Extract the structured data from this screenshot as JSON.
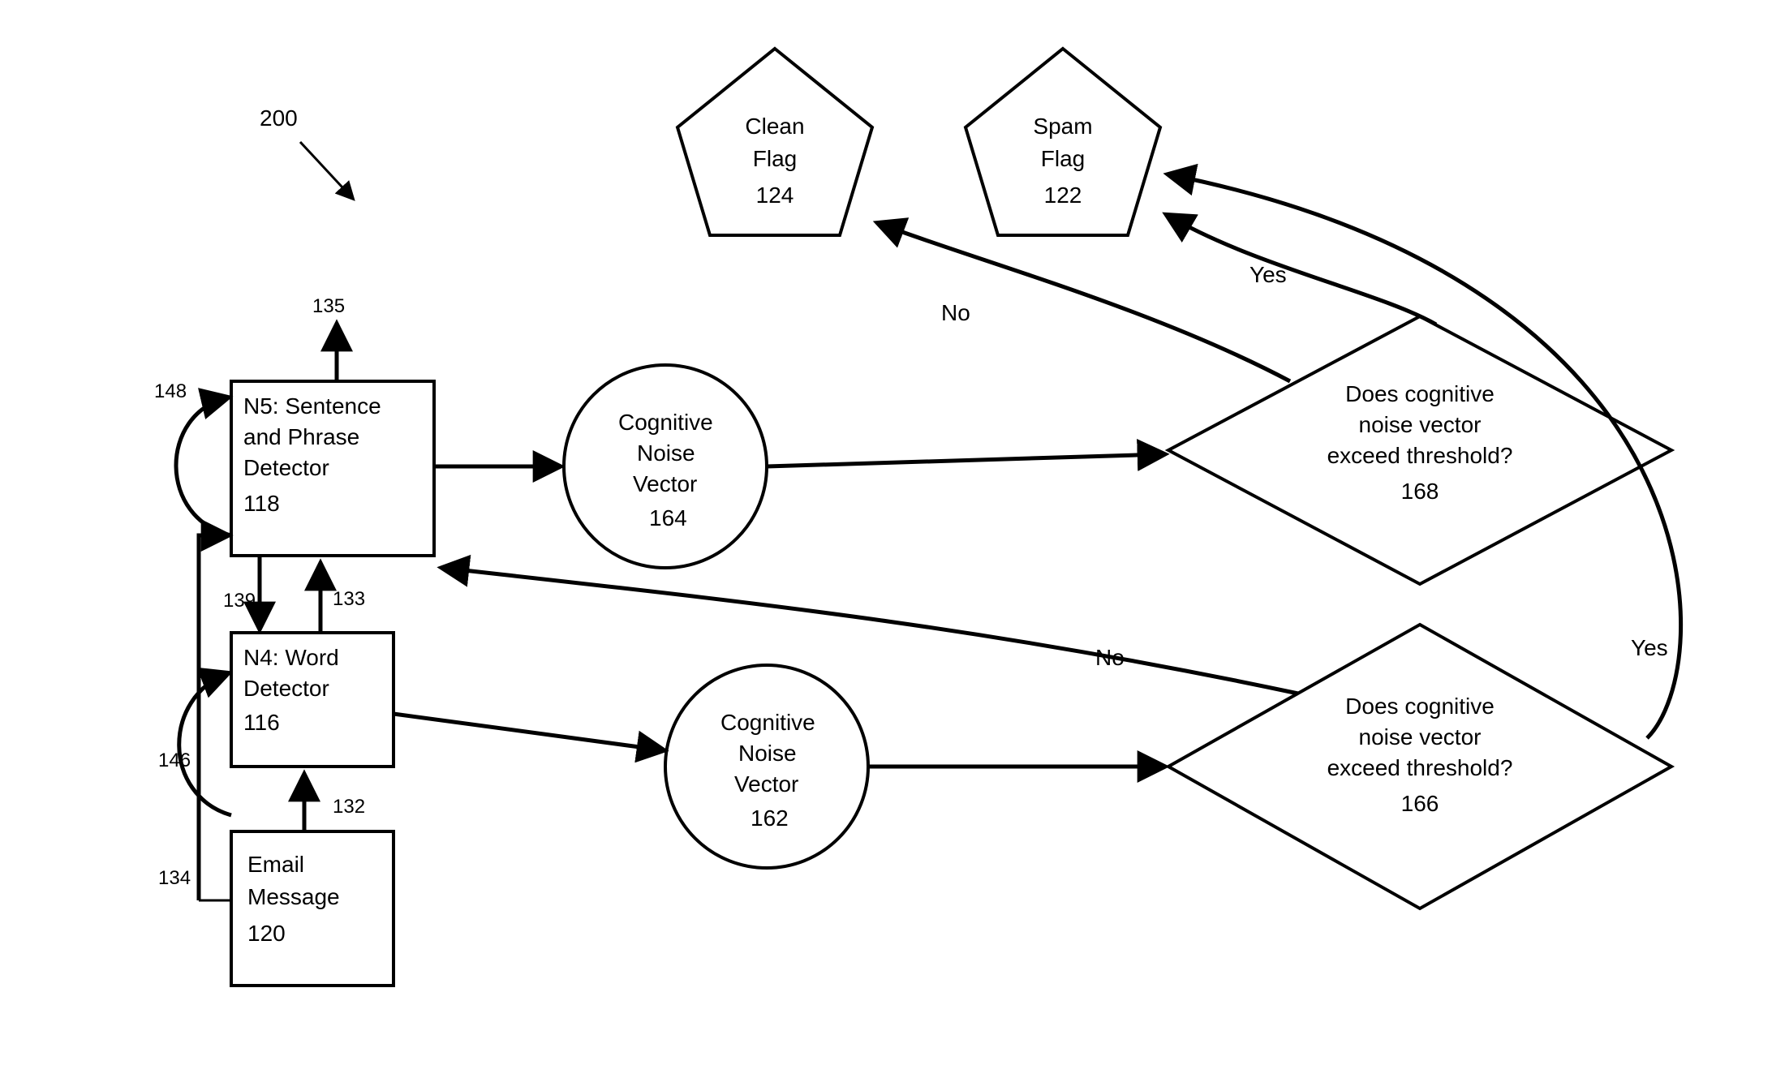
{
  "figure_ref": "200",
  "nodes": {
    "email": {
      "line1": "Email",
      "line2": "Message",
      "num": "120"
    },
    "n4": {
      "line1": "N4: Word",
      "line2": "Detector",
      "num": "116"
    },
    "n5": {
      "line1": "N5: Sentence",
      "line2": "and Phrase",
      "line3": "Detector",
      "num": "118"
    },
    "cnv1": {
      "line1": "Cognitive",
      "line2": "Noise",
      "line3": "Vector",
      "num": "162"
    },
    "cnv2": {
      "line1": "Cognitive",
      "line2": "Noise",
      "line3": "Vector",
      "num": "164"
    },
    "dec1": {
      "line1": "Does cognitive",
      "line2": "noise vector",
      "line3": "exceed threshold?",
      "num": "166"
    },
    "dec2": {
      "line1": "Does cognitive",
      "line2": "noise vector",
      "line3": "exceed threshold?",
      "num": "168"
    },
    "clean": {
      "line1": "Clean",
      "line2": "Flag",
      "num": "124"
    },
    "spam": {
      "line1": "Spam",
      "line2": "Flag",
      "num": "122"
    }
  },
  "edge_labels": {
    "no": "No",
    "yes": "Yes",
    "l132": "132",
    "l133": "133",
    "l134": "134",
    "l135": "135",
    "l139": "139",
    "l146": "146",
    "l148": "148"
  }
}
